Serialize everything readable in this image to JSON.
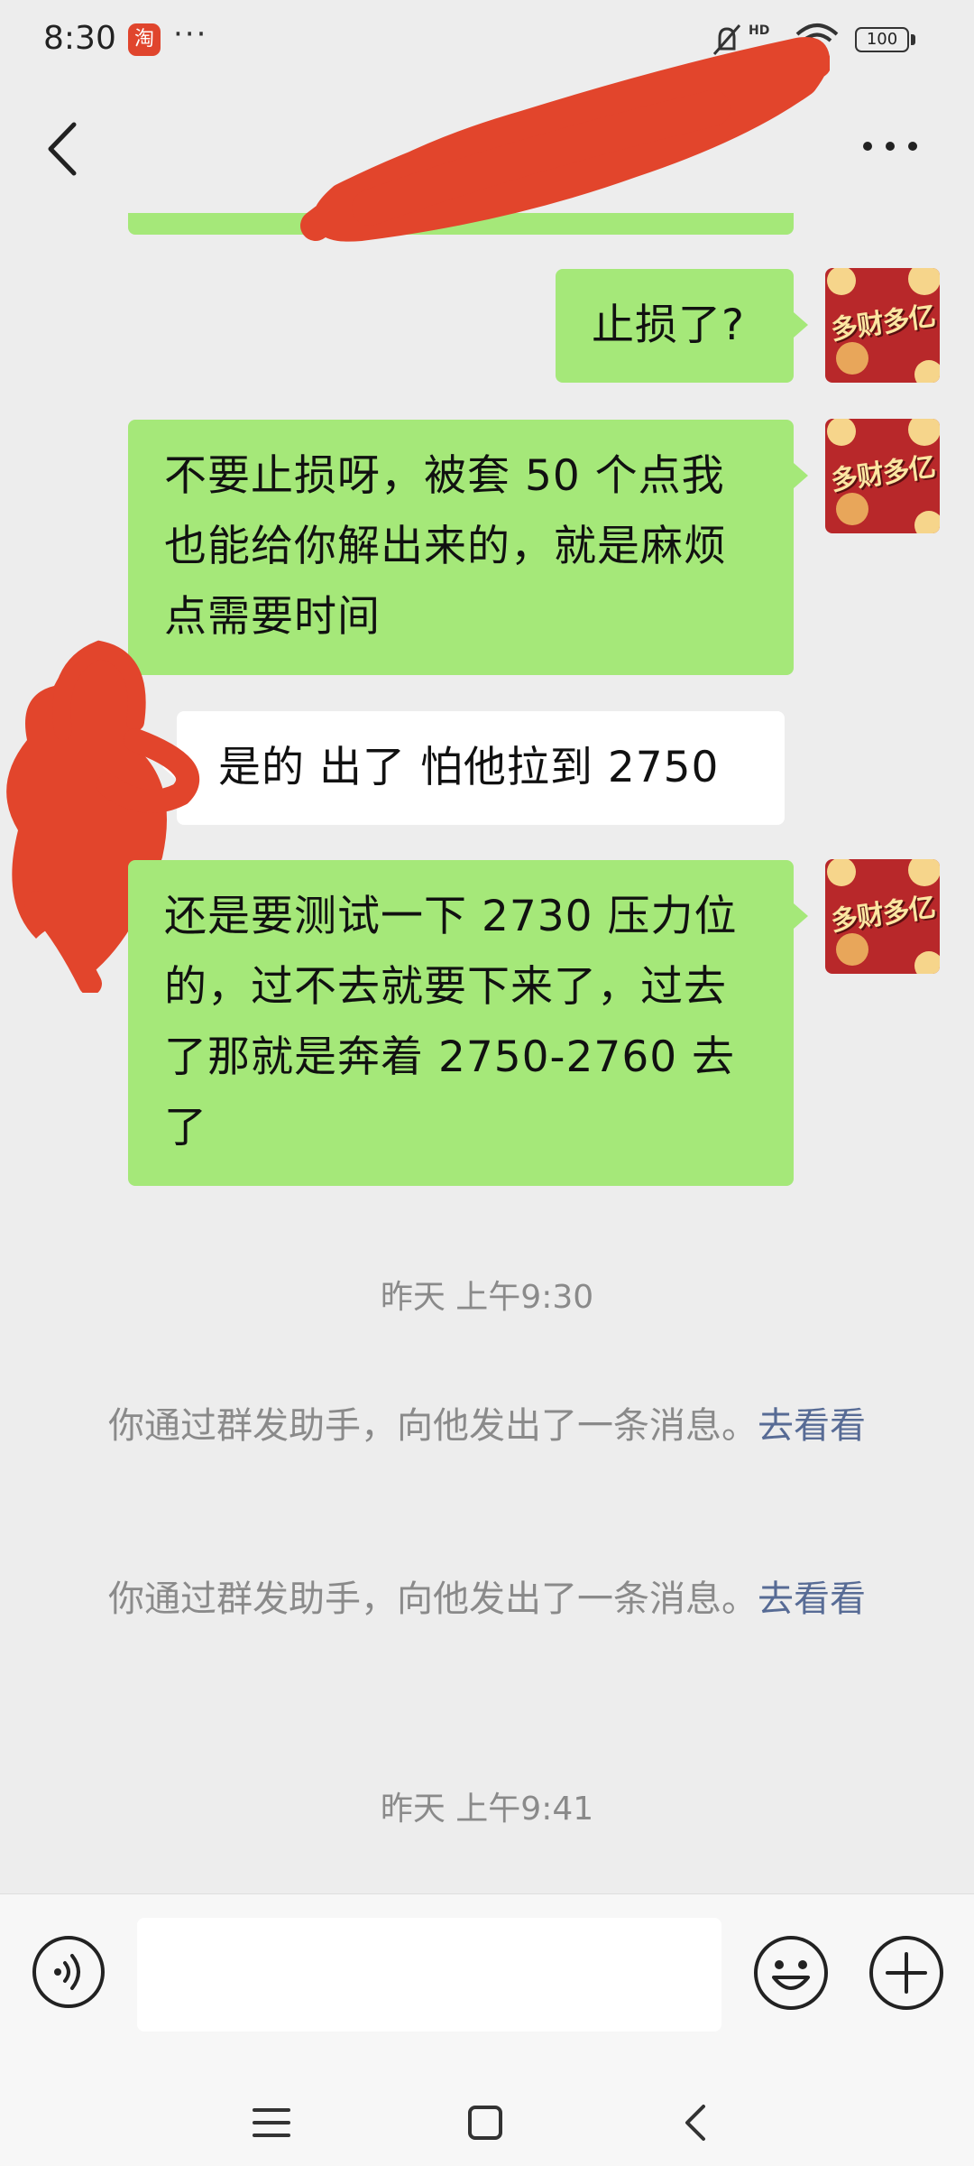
{
  "status_bar": {
    "time": "8:30",
    "app_icon_char": "淘",
    "dots": "···",
    "network": "HD",
    "battery": "100"
  },
  "nav": {
    "back_icon": "chevron-left-icon",
    "more_icon": "more-icon"
  },
  "messages": [
    {
      "side": "right",
      "text": "止损了?"
    },
    {
      "side": "right",
      "text": "不要止损呀，被套 50 个点我也能给你解出来的，就是麻烦点需要时间"
    },
    {
      "side": "left",
      "text": "是的 出了 怕他拉到 2750"
    },
    {
      "side": "right",
      "text": "还是要测试一下 2730 压力位的，过不去就要下来了，过去了那就是奔着 2750-2760 去了"
    }
  ],
  "avatar": {
    "text": "多财多亿"
  },
  "timestamps": [
    "昨天 上午9:30",
    "昨天 上午9:41"
  ],
  "system_notes": [
    {
      "text": "你通过群发助手，向他发出了一条消息。",
      "link": "去看看"
    },
    {
      "text": "你通过群发助手，向他发出了一条消息。",
      "link": "去看看"
    }
  ],
  "colors": {
    "background": "#ededed",
    "bubble_self": "#a5e879",
    "bubble_other": "#ffffff",
    "link": "#576b95",
    "redaction": "#e2452c"
  }
}
